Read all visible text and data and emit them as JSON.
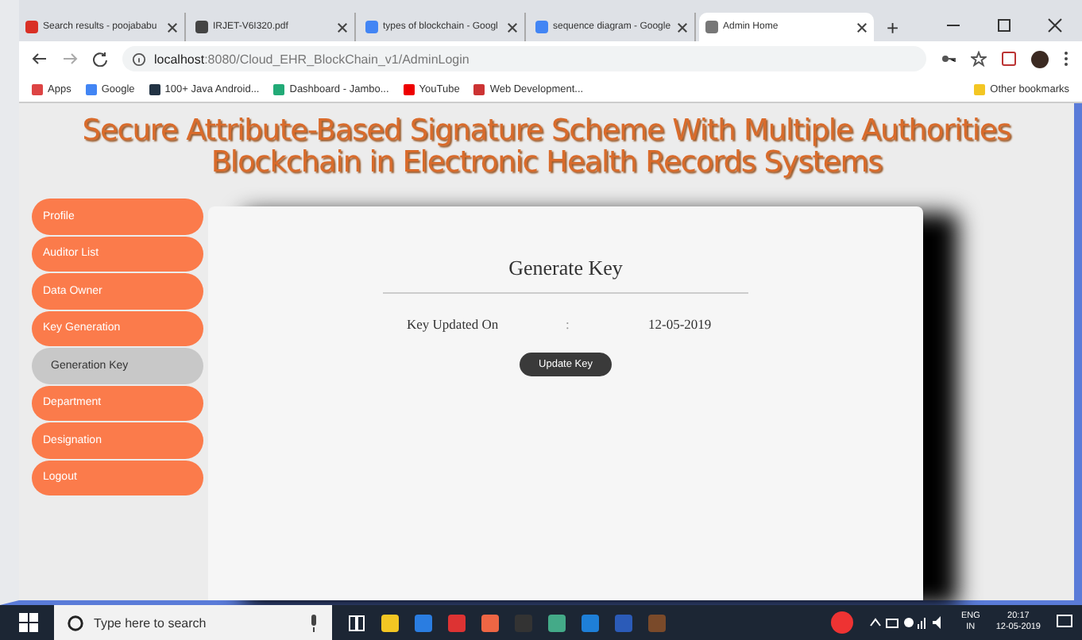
{
  "browser": {
    "tabs": [
      {
        "title": "Search results - poojababu",
        "selected": false
      },
      {
        "title": "IRJET-V6I320.pdf",
        "selected": false
      },
      {
        "title": "types of blockchain - Googl",
        "selected": false
      },
      {
        "title": "sequence diagram - Google",
        "selected": false
      },
      {
        "title": "Admin Home",
        "selected": true
      }
    ],
    "new_tab": "+",
    "url": {
      "host": "localhost",
      "path": ":8080/Cloud_EHR_BlockChain_v1/AdminLogin"
    },
    "bookmarks": [
      {
        "label": "Apps"
      },
      {
        "label": "Google"
      },
      {
        "label": "100+ Java Android..."
      },
      {
        "label": "Dashboard - Jambo..."
      },
      {
        "label": "YouTube"
      },
      {
        "label": "Web Development..."
      }
    ],
    "other_bookmarks": "Other bookmarks"
  },
  "page": {
    "title_lines": [
      "Secure Attribute-Based Signature Scheme With Multiple Authorities",
      "Blockchain in Electronic Health Records Systems"
    ],
    "menu": [
      {
        "label": "Profile",
        "selected": false
      },
      {
        "label": "Auditor List",
        "selected": false
      },
      {
        "label": "Data Owner",
        "selected": false
      },
      {
        "label": "Key Generation",
        "selected": false
      },
      {
        "label": "Generation Key",
        "selected": true
      },
      {
        "label": "Department",
        "selected": false
      },
      {
        "label": "Designation",
        "selected": false
      },
      {
        "label": "Logout",
        "selected": false
      }
    ],
    "card": {
      "heading": "Generate Key",
      "field_label": "Key Updated On",
      "separator": ":",
      "field_value": "12-05-2019",
      "button": "Update Key"
    }
  },
  "taskbar": {
    "search_placeholder": "Type here to search",
    "tray": {
      "lang": "ENG",
      "region": "IN",
      "time": "20:17",
      "date": "12-05-2019"
    }
  }
}
